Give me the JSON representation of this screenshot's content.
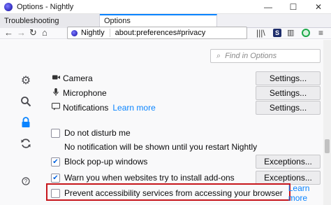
{
  "window": {
    "title": "Options - Nightly",
    "minimize": "—",
    "maximize": "☐",
    "close": "✕"
  },
  "tabs": [
    {
      "label": "Troubleshooting Information",
      "active": false
    },
    {
      "label": "Options",
      "active": true
    }
  ],
  "navbar": {
    "back": "←",
    "forward": "→",
    "reload": "↻",
    "home": "⌂",
    "url_brand": "Nightly",
    "url": "about:preferences#privacy",
    "library": "|||\\",
    "menu": "≡"
  },
  "search": {
    "placeholder": "Find in Options"
  },
  "sidebar_icons": [
    "gear-icon",
    "search-icon",
    "lock-icon",
    "sync-icon",
    "help-icon"
  ],
  "permissions": {
    "camera": {
      "label": "Camera",
      "button": "Settings..."
    },
    "microphone": {
      "label": "Microphone",
      "button": "Settings..."
    },
    "notifications": {
      "label": "Notifications",
      "link": "Learn more",
      "button": "Settings..."
    },
    "do_not_disturb": {
      "label": "Do not disturb me",
      "checked": false
    },
    "dnd_note": "No notification will be shown until you restart Nightly",
    "block_popups": {
      "label": "Block pop-up windows",
      "checked": true,
      "button": "Exceptions..."
    },
    "warn_addons": {
      "label": "Warn you when websites try to install add-ons",
      "checked": true,
      "button": "Exceptions..."
    },
    "prevent_a11y": {
      "label": "Prevent accessibility services from accessing your browser",
      "checked": false,
      "link": "Learn more"
    }
  },
  "colors": {
    "accent": "#0a84ff",
    "highlight_border": "#c7161c"
  }
}
